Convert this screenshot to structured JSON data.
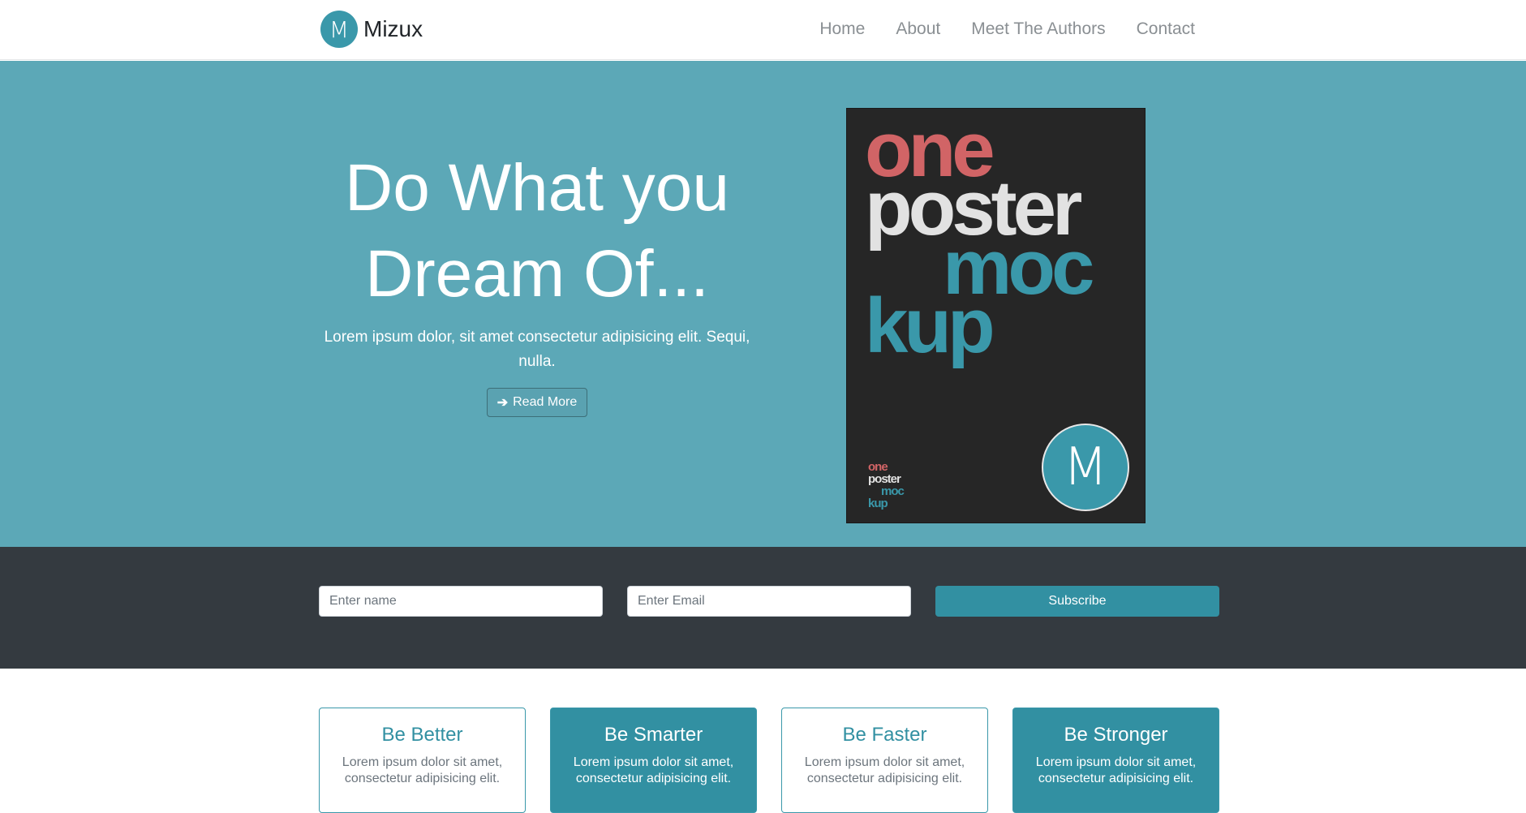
{
  "brand": {
    "logo_letter": "M",
    "name": "Mizux"
  },
  "nav": {
    "items": [
      "Home",
      "About",
      "Meet The Authors",
      "Contact"
    ]
  },
  "hero": {
    "title_line1": "Do What you",
    "title_line2": "Dream Of...",
    "subtitle": "Lorem ipsum dolor, sit amet consectetur adipisicing elit. Sequi, nulla.",
    "button_label": "Read More",
    "button_icon": "arrow-right-icon",
    "poster": {
      "word1": "one",
      "word2": "poster",
      "word3": "moc",
      "word4": "kup",
      "mini1": "one",
      "mini2": "poster",
      "mini3": "moc",
      "mini4": "kup",
      "logo_letter": "M"
    }
  },
  "subscribe": {
    "name_placeholder": "Enter name",
    "email_placeholder": "Enter Email",
    "button_label": "Subscribe"
  },
  "cards": [
    {
      "title": "Be Better",
      "body": "Lorem ipsum dolor sit amet, consectetur adipisicing elit."
    },
    {
      "title": "Be Smarter",
      "body": "Lorem ipsum dolor sit amet, consectetur adipisicing elit."
    },
    {
      "title": "Be Faster",
      "body": "Lorem ipsum dolor sit amet, consectetur adipisicing elit."
    },
    {
      "title": "Be Stronger",
      "body": "Lorem ipsum dolor sit amet, consectetur adipisicing elit."
    }
  ],
  "colors": {
    "accent": "#3290a2",
    "hero_bg": "#5ca8b7",
    "dark_band": "#343a40",
    "poster_red": "#d16466"
  }
}
